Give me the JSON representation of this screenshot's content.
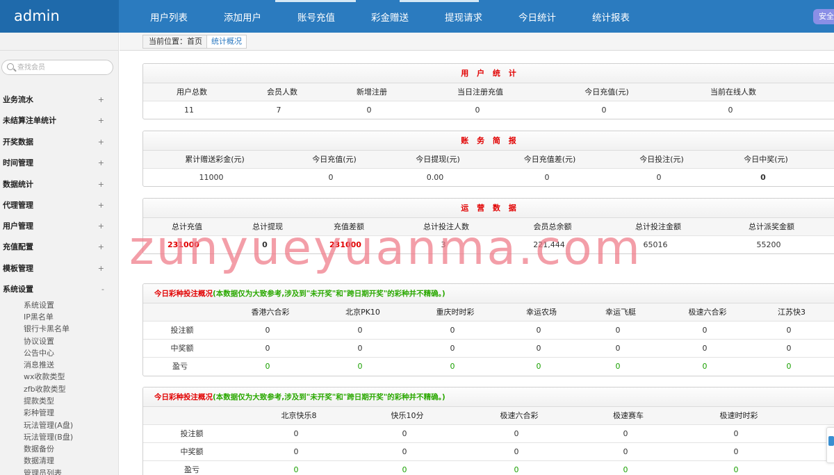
{
  "brand": "admin",
  "topnav": [
    "用户列表",
    "添加用户",
    "账号充值",
    "彩金赠送",
    "提现请求",
    "今日统计",
    "统计报表"
  ],
  "safe_label": "安全",
  "search_placeholder": "查找会员",
  "sidebar": {
    "menus": [
      {
        "label": "业务流水",
        "toggle": "+"
      },
      {
        "label": "未结算注单统计",
        "toggle": "+"
      },
      {
        "label": "开奖数据",
        "toggle": "+"
      },
      {
        "label": "时间管理",
        "toggle": "+"
      },
      {
        "label": "数据统计",
        "toggle": "+"
      },
      {
        "label": "代理管理",
        "toggle": "+"
      },
      {
        "label": "用户管理",
        "toggle": "+"
      },
      {
        "label": "充值配置",
        "toggle": "+"
      },
      {
        "label": "模板管理",
        "toggle": "+"
      },
      {
        "label": "系统设置",
        "toggle": "-"
      }
    ],
    "subitems": [
      "系统设置",
      "IP黑名单",
      "银行卡黑名单",
      "协议设置",
      "公告中心",
      "消息推送",
      "wx收款类型",
      "zfb收款类型",
      "提款类型",
      "彩种管理",
      "玩法管理(A盘)",
      "玩法管理(B盘)",
      "数据备份",
      "数据清理",
      "管理员列表"
    ]
  },
  "breadcrumb": {
    "prefix": "当前位置：首页",
    "current": "统计概况"
  },
  "user_stats": {
    "title": "用 户 统 计",
    "headers": [
      "用户总数",
      "会员人数",
      "新增注册",
      "当日注册充值",
      "今日充值(元)",
      "当前在线人数"
    ],
    "values": [
      "11",
      "7",
      "0",
      "0",
      "0",
      "0"
    ]
  },
  "account_brief": {
    "title": "账 务 简 报",
    "headers": [
      "累计赠送彩金(元)",
      "今日充值(元)",
      "今日提现(元)",
      "今日充值差(元)",
      "今日投注(元)",
      "今日中奖(元)"
    ],
    "values": [
      "11000",
      "0",
      "0.00",
      "0",
      "0",
      "0"
    ]
  },
  "ops_data": {
    "title": "运 营 数 据",
    "headers": [
      "总计充值",
      "总计提现",
      "充值差额",
      "总计投注人数",
      "会员总余额",
      "总计投注金额",
      "总计派奖金额"
    ],
    "values": [
      "231000",
      "0",
      "231000",
      "3",
      "221,444",
      "65016",
      "55200"
    ]
  },
  "lottery1": {
    "title": "今日彩种投注概况",
    "note": "(本数据仅为大致参考,涉及到\"未开奖\"和\"跨日期开奖\"的彩种并不精确。)",
    "headers": [
      "香港六合彩",
      "北京PK10",
      "重庆时时彩",
      "幸运农场",
      "幸运飞艇",
      "极速六合彩",
      "江苏快3"
    ],
    "rows": [
      {
        "label": "投注额",
        "values": [
          "0",
          "0",
          "0",
          "0",
          "0",
          "0",
          "0"
        ]
      },
      {
        "label": "中奖额",
        "values": [
          "0",
          "0",
          "0",
          "0",
          "0",
          "0",
          "0"
        ]
      },
      {
        "label": "盈亏",
        "values": [
          "0",
          "0",
          "0",
          "0",
          "0",
          "0",
          "0"
        ]
      }
    ]
  },
  "lottery2": {
    "title": "今日彩种投注概况",
    "note": "(本数据仅为大致参考,涉及到\"未开奖\"和\"跨日期开奖\"的彩种并不精确。)",
    "headers": [
      "北京快乐8",
      "快乐10分",
      "极速六合彩",
      "极速赛车",
      "极速时时彩"
    ],
    "rows": [
      {
        "label": "投注额",
        "values": [
          "0",
          "0",
          "0",
          "0",
          "0"
        ]
      },
      {
        "label": "中奖额",
        "values": [
          "0",
          "0",
          "0",
          "0",
          "0"
        ]
      },
      {
        "label": "盈亏",
        "values": [
          "0",
          "0",
          "0",
          "0",
          "0"
        ]
      }
    ]
  },
  "watermark": "zunyueyuanma.com"
}
